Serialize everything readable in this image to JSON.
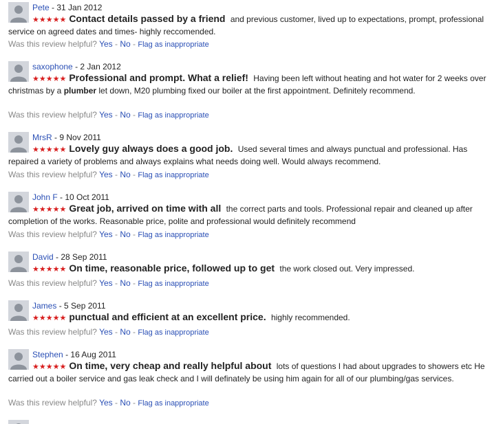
{
  "helpful_prompt": "Was this review helpful?",
  "yes_label": "Yes",
  "dash": "-",
  "no_label": "No",
  "flag_label": "Flag as inappropriate",
  "star_glyphs": "★★★★★",
  "reviews": [
    {
      "author": "Pete",
      "date": "- 31 Jan 2012",
      "rating": 5,
      "title": "Contact details passed by a friend",
      "text": "and previous customer, lived up to expectations, prompt, professional service on agreed dates and times- highly reccomended."
    },
    {
      "author": "saxophone",
      "date": "- 2 Jan 2012",
      "rating": 5,
      "title": "Professional and prompt. What a relief!",
      "text_before": "Having been left without heating and hot water for 2 weeks over christmas by a",
      "text_bold": "plumber",
      "text_after": "let down, M20 plumbing fixed our boiler at the first appointment. Definitely recommend."
    },
    {
      "author": "MrsR",
      "date": "- 9 Nov 2011",
      "rating": 5,
      "title": "Lovely guy always does a good job.",
      "text": "Used several times and always punctual and professional. Has repaired a variety of problems and always explains what needs doing well. Would always recommend."
    },
    {
      "author": "John F",
      "date": "- 10 Oct 2011",
      "rating": 5,
      "title": "Great job, arrived on time with all",
      "text": "the correct parts and tools. Professional repair and cleaned up after completion of the works. Reasonable price, polite and professional would definitely recommend"
    },
    {
      "author": "David",
      "date": "- 28 Sep 2011",
      "rating": 5,
      "title": "On time, reasonable price, followed up to get",
      "text": "the work closed out. Very impressed."
    },
    {
      "author": "James",
      "date": "- 5 Sep 2011",
      "rating": 5,
      "title": "punctual and efficient at an excellent price.",
      "text": "highly recommended."
    },
    {
      "author": "Stephen",
      "date": "- 16 Aug 2011",
      "rating": 5,
      "title": "On time, very cheap and really helpful about",
      "text": "lots of questions I had about upgrades to showers etc He carried out a boiler service and gas leak check and I will definately be using him again for all of our plumbing/gas services."
    }
  ]
}
